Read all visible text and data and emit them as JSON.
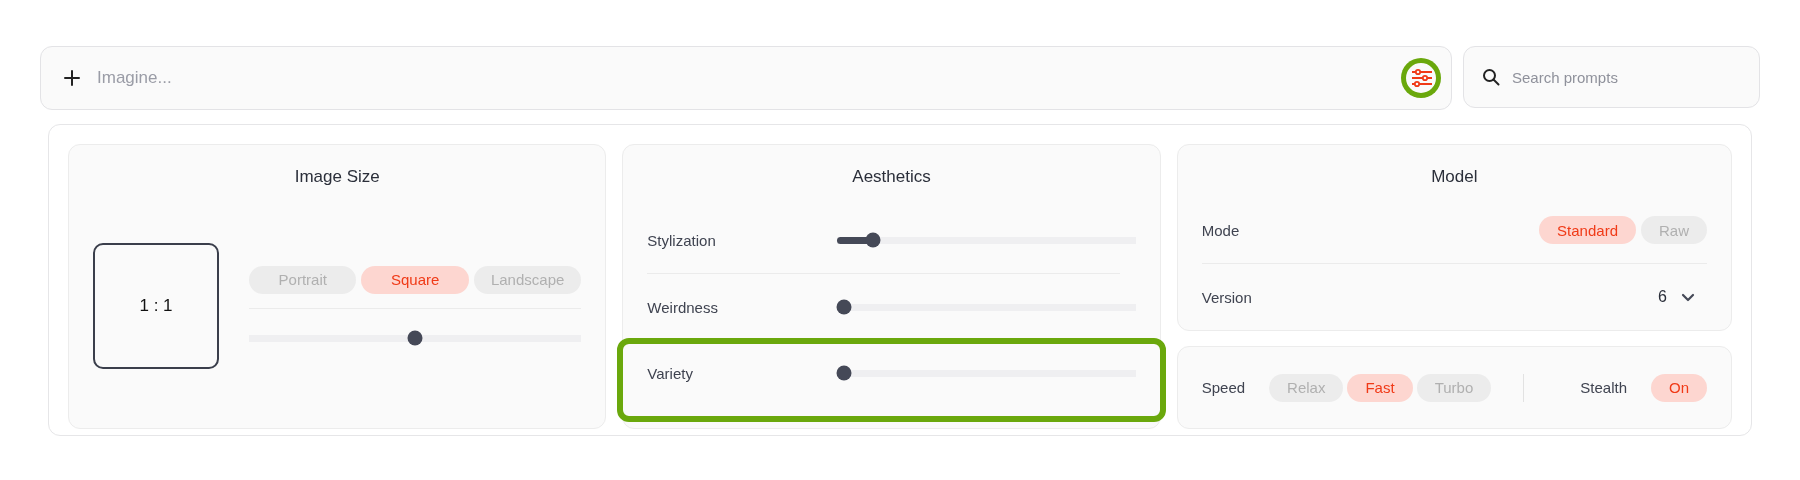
{
  "prompt_bar": {
    "placeholder": "Imagine...",
    "settings_highlighted": true
  },
  "search": {
    "placeholder": "Search prompts"
  },
  "image_size": {
    "title": "Image Size",
    "ratio": "1 : 1",
    "options": [
      {
        "label": "Portrait",
        "selected": false
      },
      {
        "label": "Square",
        "selected": true
      },
      {
        "label": "Landscape",
        "selected": false
      }
    ],
    "slider": {
      "level": 0.5
    }
  },
  "aesthetics": {
    "title": "Aesthetics",
    "sliders": [
      {
        "label": "Stylization",
        "level": 0.1,
        "highlighted": false
      },
      {
        "label": "Weirdness",
        "level": 0,
        "highlighted": false
      },
      {
        "label": "Variety",
        "level": 0,
        "highlighted": true
      }
    ]
  },
  "model": {
    "title": "Model",
    "mode": {
      "label": "Mode",
      "options": [
        {
          "label": "Standard",
          "selected": true
        },
        {
          "label": "Raw",
          "selected": false
        }
      ]
    },
    "version": {
      "label": "Version",
      "value": "6"
    }
  },
  "speed": {
    "label": "Speed",
    "options": [
      {
        "label": "Relax",
        "selected": false
      },
      {
        "label": "Fast",
        "selected": true
      },
      {
        "label": "Turbo",
        "selected": false
      }
    ]
  },
  "stealth": {
    "label": "Stealth",
    "value": "On",
    "on": true
  }
}
